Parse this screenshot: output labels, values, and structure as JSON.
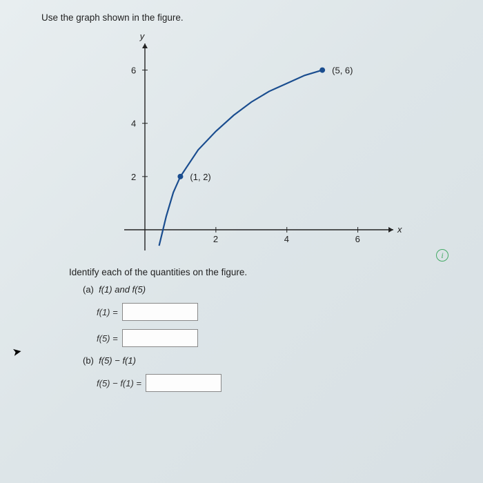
{
  "instruction": "Use the graph shown in the figure.",
  "question": "Identify each of the quantities on the figure.",
  "parts": {
    "a": {
      "label": "(a)",
      "prompt": "f(1) and f(5)",
      "rows": [
        {
          "lhs": "f(1) =",
          "value": ""
        },
        {
          "lhs": "f(5) =",
          "value": ""
        }
      ]
    },
    "b": {
      "label": "(b)",
      "prompt": "f(5) − f(1)",
      "rows": [
        {
          "lhs": "f(5) − f(1) =",
          "value": ""
        }
      ]
    }
  },
  "info_icon": "i",
  "chart_data": {
    "type": "line",
    "title": "",
    "xlabel": "x",
    "ylabel": "y",
    "xlim": [
      -0.5,
      7
    ],
    "ylim": [
      -1,
      7
    ],
    "xticks": [
      2,
      4,
      6
    ],
    "yticks": [
      2,
      4,
      6
    ],
    "points_labeled": [
      {
        "x": 1,
        "y": 2,
        "label": "(1, 2)"
      },
      {
        "x": 5,
        "y": 6,
        "label": "(5, 6)"
      }
    ],
    "series": [
      {
        "name": "f",
        "x": [
          0.4,
          0.6,
          0.8,
          1.0,
          1.5,
          2.0,
          2.5,
          3.0,
          3.5,
          4.0,
          4.5,
          5.0
        ],
        "y": [
          -0.6,
          0.5,
          1.4,
          2.0,
          3.0,
          3.7,
          4.3,
          4.8,
          5.2,
          5.5,
          5.8,
          6.0
        ]
      }
    ]
  }
}
